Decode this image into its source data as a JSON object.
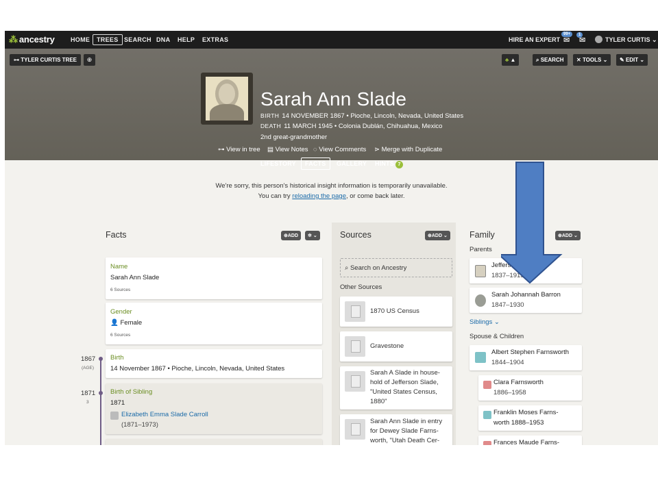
{
  "nav": {
    "logo": "ancestry",
    "items": [
      "HOME",
      "TREES",
      "SEARCH",
      "DNA",
      "HELP",
      "EXTRAS"
    ],
    "active": "TREES",
    "hire_expert": "HIRE AN EXPERT",
    "msg_badge": "99+",
    "notif_badge": "1",
    "user": "TYLER CURTIS"
  },
  "header": {
    "tree_button": "TYLER CURTIS TREE",
    "search_btn": "SEARCH",
    "tools_btn": "TOOLS",
    "edit_btn": "EDIT",
    "name": "Sarah Ann Slade",
    "birth_label": "BIRTH",
    "birth_value": "14 NOVEMBER 1867 • Pioche, Lincoln, Nevada, United States",
    "death_label": "DEATH",
    "death_value": "11 MARCH 1945 • Colonia Dublán, Chihuahua, Mexico",
    "relationship": "2nd great-grandmother",
    "actions": [
      "View in tree",
      "View Notes",
      "View Comments",
      "Merge with Duplicate"
    ],
    "tabs": [
      "LIFESTORY",
      "FACTS",
      "GALLERY",
      "HINTS"
    ],
    "active_tab": "FACTS",
    "hints_count": "7"
  },
  "message": {
    "line1": "We're sorry, this person's historical insight information is temporarily unavailable.",
    "line2_pre": "You can try ",
    "line2_link": "reloading the page",
    "line2_post": ", or come back later."
  },
  "facts": {
    "title": "Facts",
    "add": "ADD",
    "cards": [
      {
        "title": "Name",
        "value": "Sarah Ann Slade",
        "sources": "6 Sources"
      },
      {
        "title": "Gender",
        "value": "Female",
        "sources": "6 Sources"
      },
      {
        "title": "Birth",
        "value": "14 November 1867 • Pioche, Lincoln, Nevada, United States"
      },
      {
        "title": "Birth of Sibling",
        "value": "1871",
        "person": "Elizabeth Emma Slade Carroll",
        "person_years": "(1871–1973)"
      }
    ],
    "timeline": [
      {
        "year": "1867",
        "sub": "(AGE)"
      },
      {
        "year": "1871",
        "sub": "3"
      }
    ]
  },
  "sources": {
    "title": "Sources",
    "add": "ADD",
    "search": "Search on Ancestry",
    "other_label": "Other Sources",
    "items": [
      [
        "1870 US Census"
      ],
      [
        "Gravestone"
      ],
      [
        "Sarah A Slade in house-",
        "hold of Jefferson Slade,",
        "\"United States Census,",
        "1880\""
      ],
      [
        "Sarah Ann Slade in entry",
        "for Dewey Slade Farns-",
        "worth, \"Utah Death Cer-"
      ]
    ]
  },
  "family": {
    "title": "Family",
    "add": "ADD",
    "parents_label": "Parents",
    "parents": [
      {
        "name": "Jefferson Slade",
        "years": "1837–1915"
      },
      {
        "name": "Sarah Johannah Barron",
        "years": "1847–1930"
      }
    ],
    "siblings_label": "Siblings",
    "spouse_label": "Spouse & Children",
    "spouse": {
      "name": "Albert Stephen Farnsworth",
      "years": "1844–1904"
    },
    "children": [
      {
        "name": "Clara Farnsworth",
        "years": "1886–1958"
      },
      {
        "name": "Franklin Moses Farns-",
        "name2": "worth",
        "years": "1888–1953"
      },
      {
        "name": "Frances Maude Farns-"
      }
    ]
  },
  "colors": {
    "nav_bg": "#1d1d1d",
    "header_bg": "#6d6a64",
    "accent_green": "#9bbf3a",
    "link_blue": "#1a6aa8",
    "arrow_fill": "#4f7ec3",
    "arrow_stroke": "#2f528f"
  }
}
